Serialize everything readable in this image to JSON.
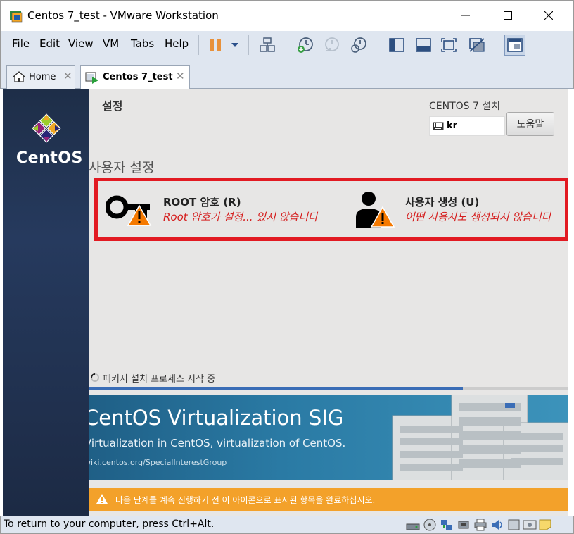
{
  "window": {
    "title": "Centos 7_test - VMware Workstation"
  },
  "menu": [
    "File",
    "Edit",
    "View",
    "VM",
    "Tabs",
    "Help"
  ],
  "tabs": [
    {
      "label": "Home",
      "icon": "home-icon"
    },
    {
      "label": "Centos 7_test",
      "icon": "vm-icon",
      "active": true
    }
  ],
  "installer": {
    "header_title": "설정",
    "install_title": "CENTOS 7 설치",
    "keyboard_layout": "kr",
    "help_button": "도움말",
    "section_title": "사용자 설정",
    "spokes": [
      {
        "title": "ROOT 암호 (R)",
        "status": "Root 암호가 설정... 있지 않습니다",
        "icon": "root-key-warning-icon"
      },
      {
        "title": "사용자 생성 (U)",
        "status": "어떤 사용자도 생성되지 않습니다",
        "icon": "user-warning-icon"
      }
    ],
    "progress_label": "패키지 설치 프로세스 시작 중",
    "progress_fraction": 0.78,
    "banner": {
      "title": "CentOS Virtualization SIG",
      "subtitle": "Virtualization in CentOS, virtualization of CentOS.",
      "url": "wiki.centos.org/SpecialInterestGroup"
    },
    "warning_text": "다음 단계를 계속 진행하기 전 이 아이콘으로 표시된 항목을 완료하십시오."
  },
  "statusbar": {
    "text": "To return to your computer, press Ctrl+Alt."
  },
  "colors": {
    "sidebar": "#1e2e48",
    "warning_red": "#e21a22",
    "warning_bar": "#f3a12a",
    "status_red": "#d51d1d"
  }
}
